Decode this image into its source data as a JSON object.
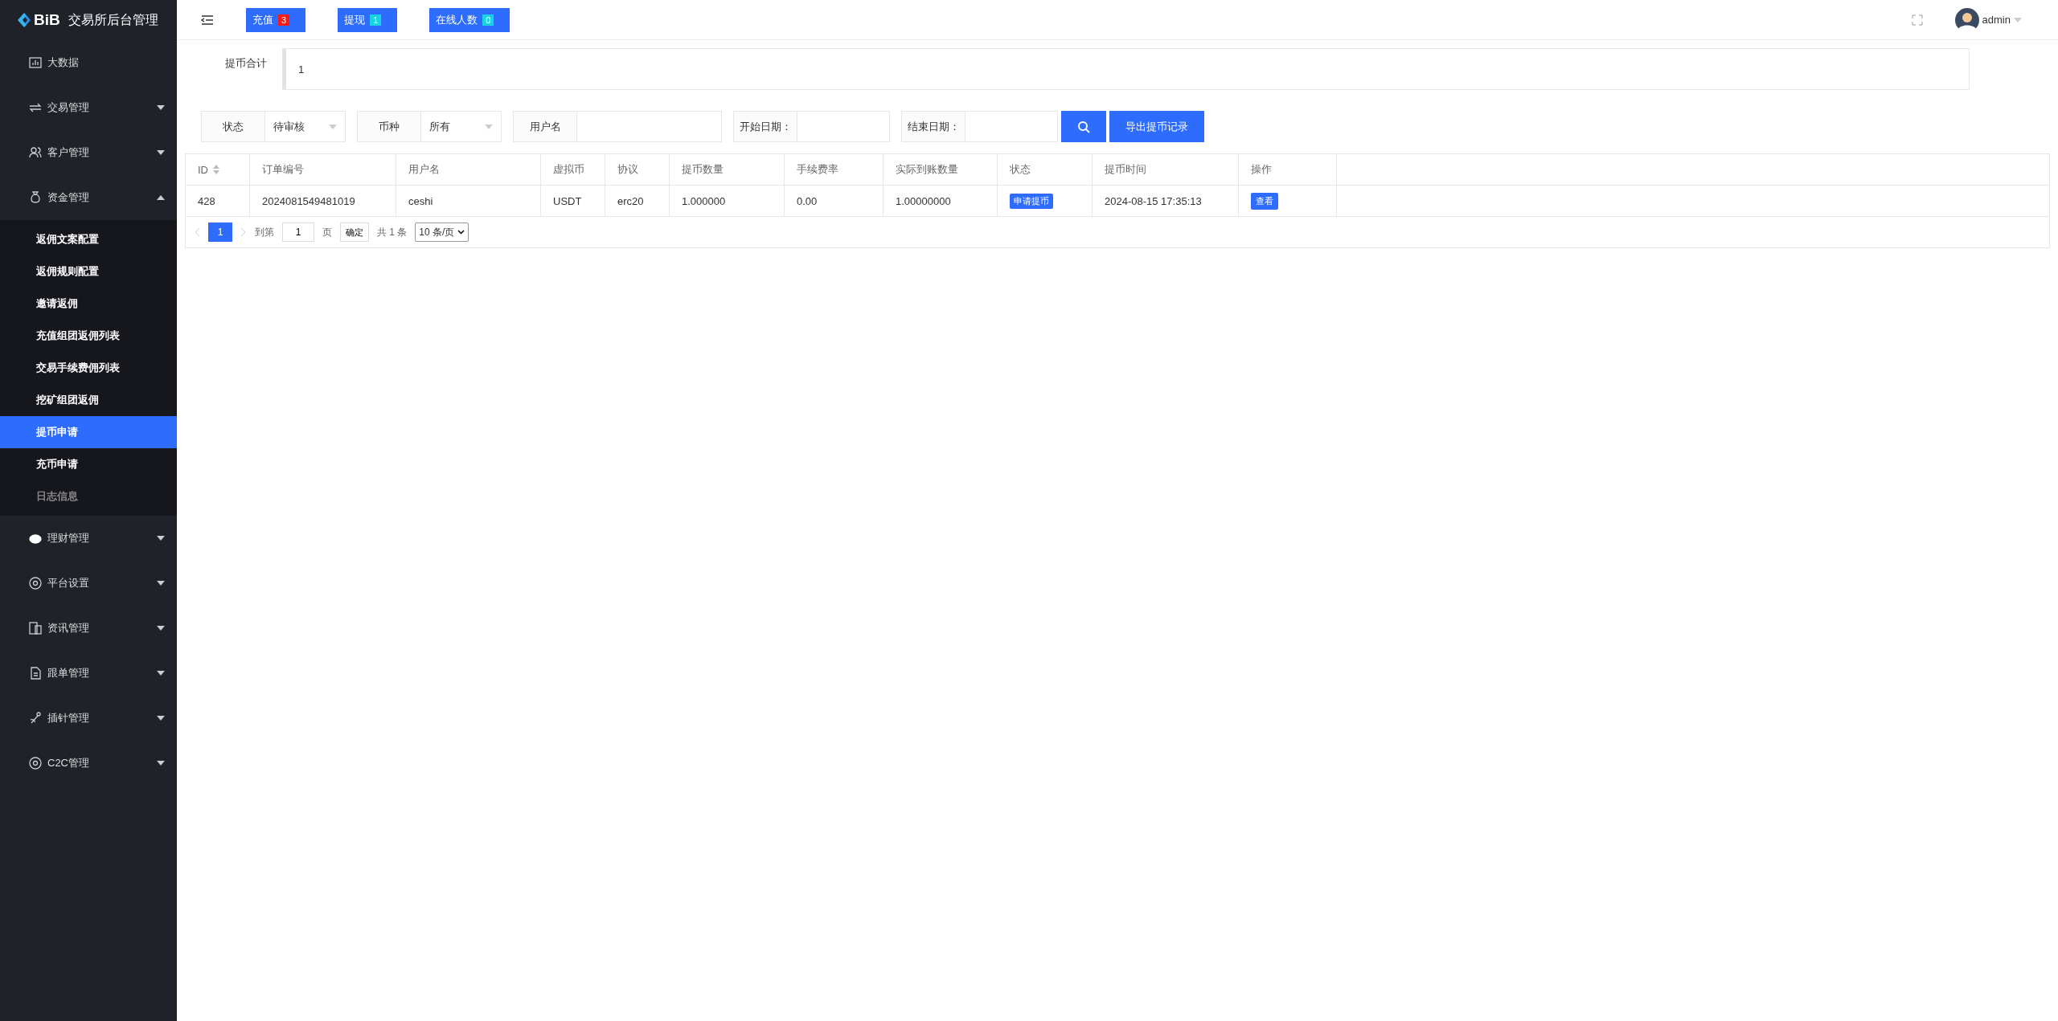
{
  "sidebar": {
    "logo": "BiB",
    "title": "交易所后台管理",
    "items": [
      {
        "label": "大数据",
        "kind": "link"
      },
      {
        "label": "交易管理",
        "kind": "menu",
        "expanded": false
      },
      {
        "label": "客户管理",
        "kind": "menu",
        "expanded": false
      },
      {
        "label": "资金管理",
        "kind": "menu",
        "expanded": true,
        "children": [
          {
            "label": "返佣文案配置",
            "selected": false,
            "disabled": false
          },
          {
            "label": "返佣规则配置",
            "selected": false,
            "disabled": false
          },
          {
            "label": "邀请返佣",
            "selected": false,
            "disabled": false
          },
          {
            "label": "充值组团返佣列表",
            "selected": false,
            "disabled": false
          },
          {
            "label": "交易手续费佣列表",
            "selected": false,
            "disabled": false
          },
          {
            "label": "挖矿组团返佣",
            "selected": false,
            "disabled": false
          },
          {
            "label": "提币申请",
            "selected": true,
            "disabled": false
          },
          {
            "label": "充币申请",
            "selected": false,
            "disabled": false
          },
          {
            "label": "日志信息",
            "selected": false,
            "disabled": true
          }
        ]
      },
      {
        "label": "理财管理",
        "kind": "menu",
        "expanded": false
      },
      {
        "label": "平台设置",
        "kind": "menu",
        "expanded": false
      },
      {
        "label": "资讯管理",
        "kind": "menu",
        "expanded": false
      },
      {
        "label": "跟单管理",
        "kind": "menu",
        "expanded": false
      },
      {
        "label": "插针管理",
        "kind": "menu",
        "expanded": false
      },
      {
        "label": "C2C管理",
        "kind": "menu",
        "expanded": false
      }
    ]
  },
  "topbar": {
    "badges": [
      {
        "label": "充值",
        "count": "3",
        "color": "#ff1a1a"
      },
      {
        "label": "提现",
        "count": "1",
        "color": "#19d3e0"
      },
      {
        "label": "在线人数",
        "count": "0",
        "color": "#19d3e0"
      }
    ],
    "user": "admin"
  },
  "summary": {
    "label": "提币合计",
    "value": "1"
  },
  "filters": [
    {
      "kind": "select",
      "label": "状态",
      "value": "待审核"
    },
    {
      "kind": "select",
      "label": "币种",
      "value": "所有"
    },
    {
      "kind": "input",
      "label": "用户名"
    },
    {
      "kind": "input",
      "label": "开始日期："
    },
    {
      "kind": "input",
      "label": "结束日期："
    }
  ],
  "export_button": "导出提币记录",
  "table": {
    "columns": [
      {
        "label": "ID",
        "sortable": true
      },
      {
        "label": "订单编号",
        "sortable": false
      },
      {
        "label": "用户名",
        "sortable": false
      },
      {
        "label": "虚拟币",
        "sortable": false
      },
      {
        "label": "协议",
        "sortable": false
      },
      {
        "label": "提币数量",
        "sortable": false
      },
      {
        "label": "手续费率",
        "sortable": false
      },
      {
        "label": "实际到账数量",
        "sortable": false
      },
      {
        "label": "状态",
        "sortable": false
      },
      {
        "label": "提币时间",
        "sortable": false
      },
      {
        "label": "操作",
        "sortable": false
      }
    ],
    "rows": [
      {
        "cells": [
          "428",
          "2024081549481019",
          "ceshi",
          "USDT",
          "erc20",
          "1.000000",
          "0.00",
          "1.00000000"
        ],
        "status": "申请提币",
        "time": "2024-08-15 17:35:13",
        "action": "查看"
      }
    ]
  },
  "pagination": {
    "pages": [
      {
        "label": "1",
        "selected": true
      }
    ],
    "goto_label": "到第",
    "goto_value": "1",
    "page_unit": "页",
    "confirm": "确定",
    "total": "共 1 条",
    "page_size": "10 条/页"
  }
}
